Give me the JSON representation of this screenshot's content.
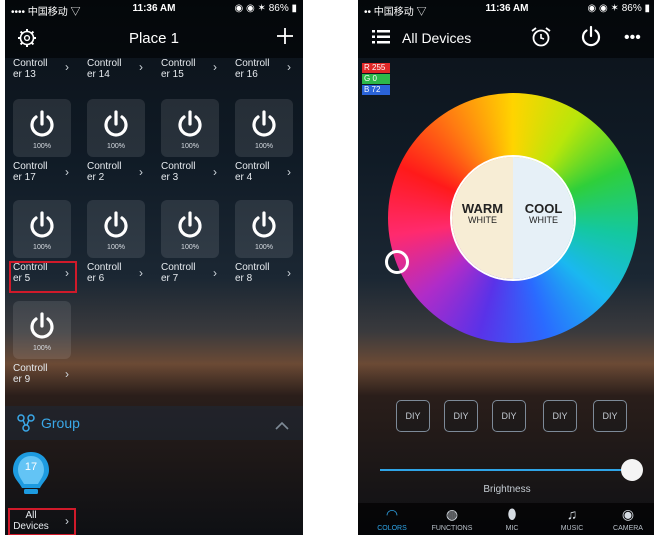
{
  "left": {
    "status": {
      "carrier": "•••• 中国移动 ▽",
      "time": "11:36 AM",
      "battery": "◉ ◉ ✶ 86% ▮"
    },
    "header": {
      "title": "Place 1",
      "settings_icon": "gear-icon",
      "add_icon": "plus-icon"
    },
    "top_row_labels": [
      {
        "line1": "Controll",
        "line2": "er 13"
      },
      {
        "line1": "Controll",
        "line2": "er 14"
      },
      {
        "line1": "Controll",
        "line2": "er 15"
      },
      {
        "line1": "Controll",
        "line2": "er 16"
      }
    ],
    "rows": [
      [
        {
          "pct": "100%",
          "line1": "Controll",
          "line2": "er 17"
        },
        {
          "pct": "100%",
          "line1": "Controll",
          "line2": "er 2"
        },
        {
          "pct": "100%",
          "line1": "Controll",
          "line2": "er 3"
        },
        {
          "pct": "100%",
          "line1": "Controll",
          "line2": "er 4"
        }
      ],
      [
        {
          "pct": "100%",
          "line1": "Controll",
          "line2": "er 5"
        },
        {
          "pct": "100%",
          "line1": "Controll",
          "line2": "er 6"
        },
        {
          "pct": "100%",
          "line1": "Controll",
          "line2": "er 7"
        },
        {
          "pct": "100%",
          "line1": "Controll",
          "line2": "er 8"
        }
      ],
      [
        {
          "pct": "100%",
          "line1": "Controll",
          "line2": "er 9"
        }
      ]
    ],
    "group": {
      "label": "Group",
      "icon": "group-icon",
      "collapse_icon": "chevron-up-icon"
    },
    "group_item": {
      "badge": "17",
      "line1": "All",
      "line2": "Devices",
      "icon": "bulb-icon"
    },
    "highlight_color": "#d01a2a"
  },
  "right": {
    "status": {
      "carrier": "•• 中国移动 ▽",
      "time": "11:36 AM",
      "battery": "◉ ◉ ✶ 86% ▮"
    },
    "header": {
      "title": "All Devices",
      "menu_icon": "list-icon",
      "alarm_icon": "alarm-icon",
      "power_icon": "power-icon",
      "more_icon": "more-icon"
    },
    "rgb": {
      "r": "R 255",
      "g": "G 0",
      "b": "B 72"
    },
    "wheel": {
      "warm_big": "WARM",
      "warm_small": "WHITE",
      "cool_big": "COOL",
      "cool_small": "WHITE"
    },
    "diy": [
      "DIY",
      "DIY",
      "DIY",
      "DIY",
      "DIY"
    ],
    "brightness": {
      "label": "Brightness",
      "value": 1.0
    },
    "tabs": [
      {
        "label": "COLORS",
        "icon": "colors-icon",
        "glyph": "◠",
        "active": true
      },
      {
        "label": "FUNCTIONS",
        "icon": "functions-icon",
        "glyph": "◍",
        "active": false
      },
      {
        "label": "MIC",
        "icon": "mic-icon",
        "glyph": "⬮",
        "active": false
      },
      {
        "label": "MUSIC",
        "icon": "music-icon",
        "glyph": "♫",
        "active": false
      },
      {
        "label": "CAMERA",
        "icon": "camera-icon",
        "glyph": "◉",
        "active": false
      }
    ],
    "accent": "#2fa4e6"
  }
}
